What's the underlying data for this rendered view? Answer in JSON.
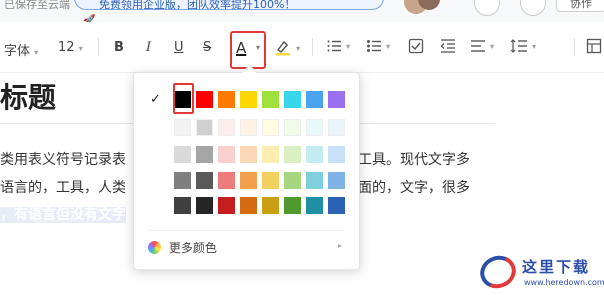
{
  "topbar": {
    "saved_text": "已保存至云端",
    "banner_text": "免费领用企业版，团队效率提升100%！",
    "collab_label": "协作"
  },
  "toolbar": {
    "font_family": "字体",
    "font_size": "12",
    "bold_label": "B",
    "italic_label": "I",
    "underline_label": "U",
    "strike_label": "S",
    "font_color_label": "A",
    "caret": "▾"
  },
  "document": {
    "title": "标题",
    "line1_left": "类用表义符号记录表",
    "line1_right": "工具。现代文字多",
    "line2_left": "语言的，工具，人类",
    "line2_right": "面的，文字，很多",
    "line3_highlight": "，有语言但没有文字"
  },
  "color_picker": {
    "selected_check": "✓",
    "selected_color": "#000000",
    "rows": [
      [
        "#000000",
        "#ff0000",
        "#ff7a00",
        "#ffd700",
        "#9ee03c",
        "#38d6ea",
        "#4aa3ec",
        "#9a6ff0"
      ],
      [
        "#f2f2f2",
        "#d0d0d0",
        "#fdecec",
        "#fff1e3",
        "#fffbe0",
        "#f1fbe8",
        "#e8f9fc",
        "#eaf4fd"
      ],
      [
        "#d9d9d9",
        "#a6a6a6",
        "#f9cfcf",
        "#fbd7b5",
        "#fbeeb0",
        "#d8f0c2",
        "#c3ecf2",
        "#c8e1f8"
      ],
      [
        "#7f7f7f",
        "#595959",
        "#ee7c7c",
        "#f2a04e",
        "#f2d060",
        "#a6d67f",
        "#7fcfdc",
        "#7fb3e8"
      ],
      [
        "#404040",
        "#262626",
        "#c41e1e",
        "#d66a10",
        "#c9a012",
        "#4f9a2c",
        "#1f8fa6",
        "#2b63b4"
      ]
    ],
    "extra_row_end": "#e6e0f5",
    "row4_end": "#b59ae6",
    "row5_end": "#5b32a8",
    "more_colors_label": "更多颜色",
    "more_caret": "▸"
  },
  "watermark": {
    "name": "这里下载",
    "url": "www.heredown.com"
  }
}
